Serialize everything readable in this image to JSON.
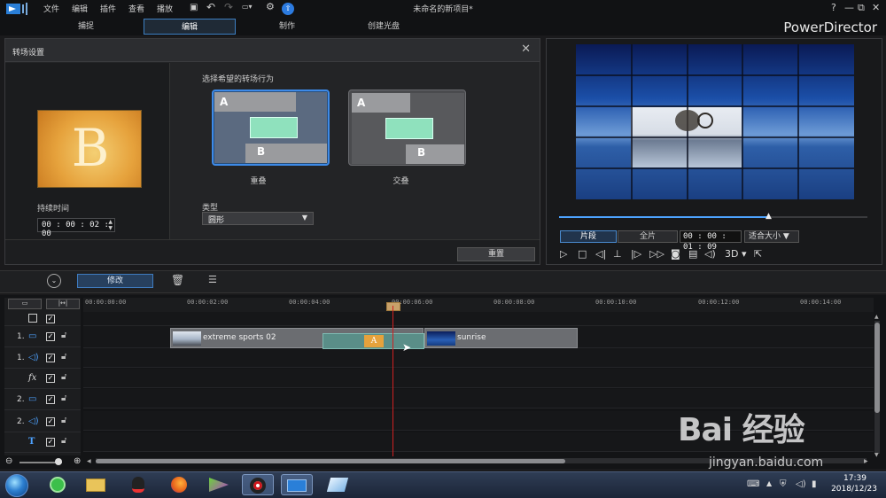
{
  "app": {
    "menus": [
      "文件",
      "编辑",
      "插件",
      "查看",
      "播放"
    ],
    "document_title": "未命名的新项目*",
    "brand": "PowerDirector",
    "window_controls": {
      "help": "?",
      "minimize": "—",
      "restore": "⧉",
      "close": "✕"
    }
  },
  "mode_tabs": [
    {
      "label": "捕捉",
      "active": false
    },
    {
      "label": "编辑",
      "active": true
    },
    {
      "label": "制作",
      "active": false
    },
    {
      "label": "创建光盘",
      "active": false
    }
  ],
  "transition_panel": {
    "title": "转场设置",
    "preview_letter": "B",
    "duration_label": "持续时间",
    "duration_value": "00 : 00 : 02 : 00",
    "behavior_label": "选择希望的转场行为",
    "behaviors": [
      {
        "label": "重叠",
        "selected": true,
        "a": "A",
        "b": "B"
      },
      {
        "label": "交叠",
        "selected": false,
        "a": "A",
        "b": "B"
      }
    ],
    "type_label": "类型",
    "type_value": "圆形",
    "reset_label": "重置"
  },
  "viewer": {
    "segment_label": "片段",
    "full_label": "全片",
    "timecode": "00 : 00 : 01 : 09",
    "fit_label": "适合大小",
    "scrub_progress": 0.68,
    "three_d_label": "3D"
  },
  "edit_toolbar": {
    "modify_label": "修改"
  },
  "timeline": {
    "ticks": [
      "00:00:00:00",
      "00:00:02:00",
      "00:00:04:00",
      "00:00:06:00",
      "00:00:08:00",
      "00:00:10:00",
      "00:00:12:00",
      "00:00:14:00"
    ],
    "tracks": [
      {
        "num": "",
        "kind": "master"
      },
      {
        "num": "1.",
        "kind": "video"
      },
      {
        "num": "1.",
        "kind": "audio"
      },
      {
        "num": "",
        "kind": "fx"
      },
      {
        "num": "2.",
        "kind": "video"
      },
      {
        "num": "2.",
        "kind": "audio"
      },
      {
        "num": "",
        "kind": "title"
      }
    ],
    "clips": [
      {
        "name": "extreme sports 02"
      },
      {
        "name": "sunrise"
      }
    ],
    "transition_letter": "A"
  },
  "taskbar": {
    "time": "17:39",
    "date": "2018/12/23"
  },
  "watermark": {
    "logo": "Bai 经验",
    "url": "jingyan.baidu.com"
  },
  "colors": {
    "accent": "#3d7fc2",
    "playhead": "#d02020",
    "transition_green": "#8fe1bd"
  }
}
